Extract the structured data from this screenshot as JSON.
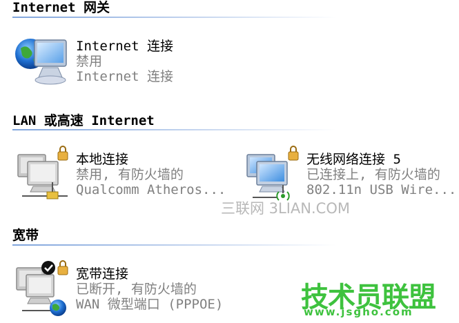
{
  "groups": {
    "internet_gateway": {
      "title": "Internet 网关",
      "items": [
        {
          "name": "Internet 连接",
          "status": "禁用",
          "device": "Internet 连接"
        }
      ]
    },
    "lan": {
      "title": "LAN 或高速 Internet",
      "items": [
        {
          "name": "本地连接",
          "status": "禁用, 有防火墙的",
          "device": "Qualcomm Atheros..."
        },
        {
          "name": "无线网络连接 5",
          "status": "已连接上, 有防火墙的",
          "device": "802.11n USB Wire..."
        }
      ]
    },
    "broadband": {
      "title": "宽带",
      "items": [
        {
          "name": "宽带连接",
          "status": "已断开, 有防火墙的",
          "device": "WAN 微型端口 (PPPOE)"
        }
      ]
    }
  },
  "watermarks": {
    "site1": "三联网 3LIAN.COM",
    "site2_title": "技术员联盟",
    "site2_url": "www.jsgho.com"
  },
  "colors": {
    "header_line": "#7fa4dc",
    "secondary_text": "#808080",
    "watermark_green": "#3ec23e"
  }
}
